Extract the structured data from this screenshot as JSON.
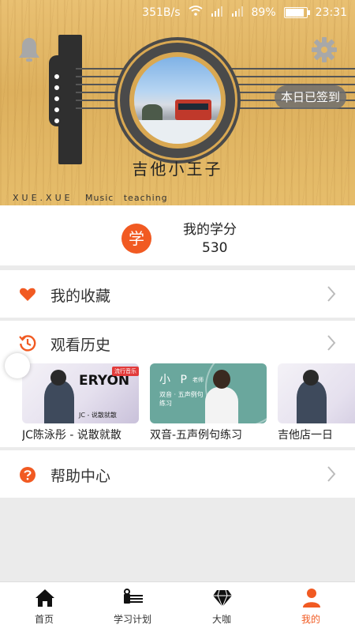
{
  "status_bar": {
    "speed": "351B/s",
    "battery": "89%",
    "battery_level": 0.89,
    "time": "23:31"
  },
  "header": {
    "checkin_label": "本日已签到",
    "username": "吉他小王子",
    "brand": "XUE.XUE",
    "brand_sub": "Music teaching"
  },
  "credits": {
    "badge": "学",
    "label": "我的学分",
    "value": "530"
  },
  "menu": {
    "favorites": "我的收藏",
    "history": "观看历史",
    "help": "帮助中心"
  },
  "history_items": [
    {
      "title": "JC陈泳彤 - 说散就散",
      "thumb_text": "ERYON",
      "thumb_tag": "流行音乐",
      "thumb_caption": "JC - 说散就散"
    },
    {
      "title": "双音-五声例句练习",
      "thumb_text": "小 P",
      "thumb_tag": "老师",
      "thumb_caption": "双音 · 五声例句练习"
    },
    {
      "title": "吉他店一日"
    }
  ],
  "tabs": [
    {
      "label": "首页",
      "icon": "home-icon"
    },
    {
      "label": "学习计划",
      "icon": "guitar-icon"
    },
    {
      "label": "大咖",
      "icon": "diamond-icon"
    },
    {
      "label": "我的",
      "icon": "person-icon",
      "active": true
    }
  ],
  "colors": {
    "accent": "#f15a22",
    "wood": "#e2b766"
  }
}
